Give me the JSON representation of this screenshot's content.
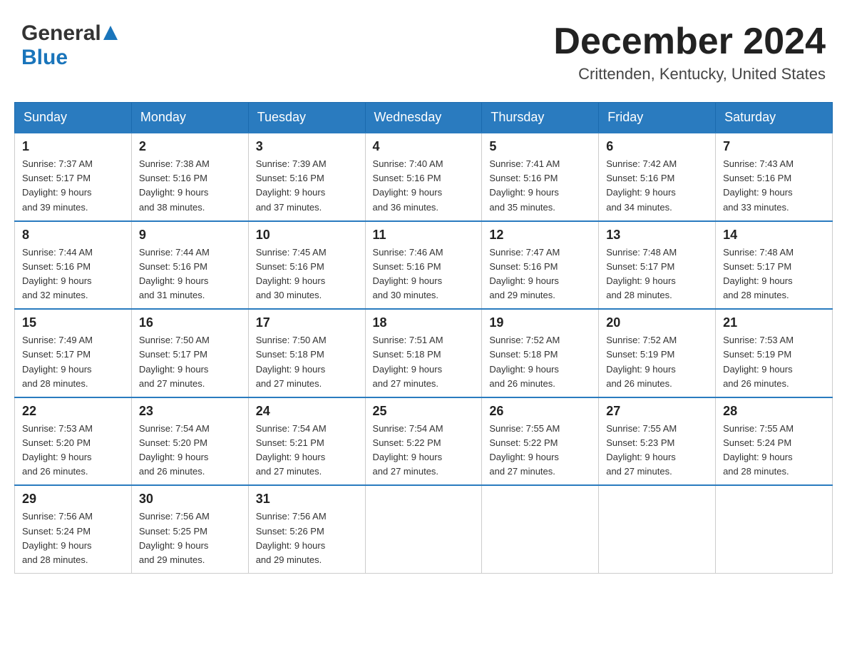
{
  "header": {
    "logo_general": "General",
    "logo_blue": "Blue",
    "month_title": "December 2024",
    "location": "Crittenden, Kentucky, United States"
  },
  "days_of_week": [
    "Sunday",
    "Monday",
    "Tuesday",
    "Wednesday",
    "Thursday",
    "Friday",
    "Saturday"
  ],
  "weeks": [
    [
      {
        "day": 1,
        "sunrise": "7:37 AM",
        "sunset": "5:17 PM",
        "daylight": "9 hours and 39 minutes."
      },
      {
        "day": 2,
        "sunrise": "7:38 AM",
        "sunset": "5:16 PM",
        "daylight": "9 hours and 38 minutes."
      },
      {
        "day": 3,
        "sunrise": "7:39 AM",
        "sunset": "5:16 PM",
        "daylight": "9 hours and 37 minutes."
      },
      {
        "day": 4,
        "sunrise": "7:40 AM",
        "sunset": "5:16 PM",
        "daylight": "9 hours and 36 minutes."
      },
      {
        "day": 5,
        "sunrise": "7:41 AM",
        "sunset": "5:16 PM",
        "daylight": "9 hours and 35 minutes."
      },
      {
        "day": 6,
        "sunrise": "7:42 AM",
        "sunset": "5:16 PM",
        "daylight": "9 hours and 34 minutes."
      },
      {
        "day": 7,
        "sunrise": "7:43 AM",
        "sunset": "5:16 PM",
        "daylight": "9 hours and 33 minutes."
      }
    ],
    [
      {
        "day": 8,
        "sunrise": "7:44 AM",
        "sunset": "5:16 PM",
        "daylight": "9 hours and 32 minutes."
      },
      {
        "day": 9,
        "sunrise": "7:44 AM",
        "sunset": "5:16 PM",
        "daylight": "9 hours and 31 minutes."
      },
      {
        "day": 10,
        "sunrise": "7:45 AM",
        "sunset": "5:16 PM",
        "daylight": "9 hours and 30 minutes."
      },
      {
        "day": 11,
        "sunrise": "7:46 AM",
        "sunset": "5:16 PM",
        "daylight": "9 hours and 30 minutes."
      },
      {
        "day": 12,
        "sunrise": "7:47 AM",
        "sunset": "5:16 PM",
        "daylight": "9 hours and 29 minutes."
      },
      {
        "day": 13,
        "sunrise": "7:48 AM",
        "sunset": "5:17 PM",
        "daylight": "9 hours and 28 minutes."
      },
      {
        "day": 14,
        "sunrise": "7:48 AM",
        "sunset": "5:17 PM",
        "daylight": "9 hours and 28 minutes."
      }
    ],
    [
      {
        "day": 15,
        "sunrise": "7:49 AM",
        "sunset": "5:17 PM",
        "daylight": "9 hours and 28 minutes."
      },
      {
        "day": 16,
        "sunrise": "7:50 AM",
        "sunset": "5:17 PM",
        "daylight": "9 hours and 27 minutes."
      },
      {
        "day": 17,
        "sunrise": "7:50 AM",
        "sunset": "5:18 PM",
        "daylight": "9 hours and 27 minutes."
      },
      {
        "day": 18,
        "sunrise": "7:51 AM",
        "sunset": "5:18 PM",
        "daylight": "9 hours and 27 minutes."
      },
      {
        "day": 19,
        "sunrise": "7:52 AM",
        "sunset": "5:18 PM",
        "daylight": "9 hours and 26 minutes."
      },
      {
        "day": 20,
        "sunrise": "7:52 AM",
        "sunset": "5:19 PM",
        "daylight": "9 hours and 26 minutes."
      },
      {
        "day": 21,
        "sunrise": "7:53 AM",
        "sunset": "5:19 PM",
        "daylight": "9 hours and 26 minutes."
      }
    ],
    [
      {
        "day": 22,
        "sunrise": "7:53 AM",
        "sunset": "5:20 PM",
        "daylight": "9 hours and 26 minutes."
      },
      {
        "day": 23,
        "sunrise": "7:54 AM",
        "sunset": "5:20 PM",
        "daylight": "9 hours and 26 minutes."
      },
      {
        "day": 24,
        "sunrise": "7:54 AM",
        "sunset": "5:21 PM",
        "daylight": "9 hours and 27 minutes."
      },
      {
        "day": 25,
        "sunrise": "7:54 AM",
        "sunset": "5:22 PM",
        "daylight": "9 hours and 27 minutes."
      },
      {
        "day": 26,
        "sunrise": "7:55 AM",
        "sunset": "5:22 PM",
        "daylight": "9 hours and 27 minutes."
      },
      {
        "day": 27,
        "sunrise": "7:55 AM",
        "sunset": "5:23 PM",
        "daylight": "9 hours and 27 minutes."
      },
      {
        "day": 28,
        "sunrise": "7:55 AM",
        "sunset": "5:24 PM",
        "daylight": "9 hours and 28 minutes."
      }
    ],
    [
      {
        "day": 29,
        "sunrise": "7:56 AM",
        "sunset": "5:24 PM",
        "daylight": "9 hours and 28 minutes."
      },
      {
        "day": 30,
        "sunrise": "7:56 AM",
        "sunset": "5:25 PM",
        "daylight": "9 hours and 29 minutes."
      },
      {
        "day": 31,
        "sunrise": "7:56 AM",
        "sunset": "5:26 PM",
        "daylight": "9 hours and 29 minutes."
      },
      null,
      null,
      null,
      null
    ]
  ],
  "labels": {
    "sunrise": "Sunrise:",
    "sunset": "Sunset:",
    "daylight": "Daylight:"
  }
}
